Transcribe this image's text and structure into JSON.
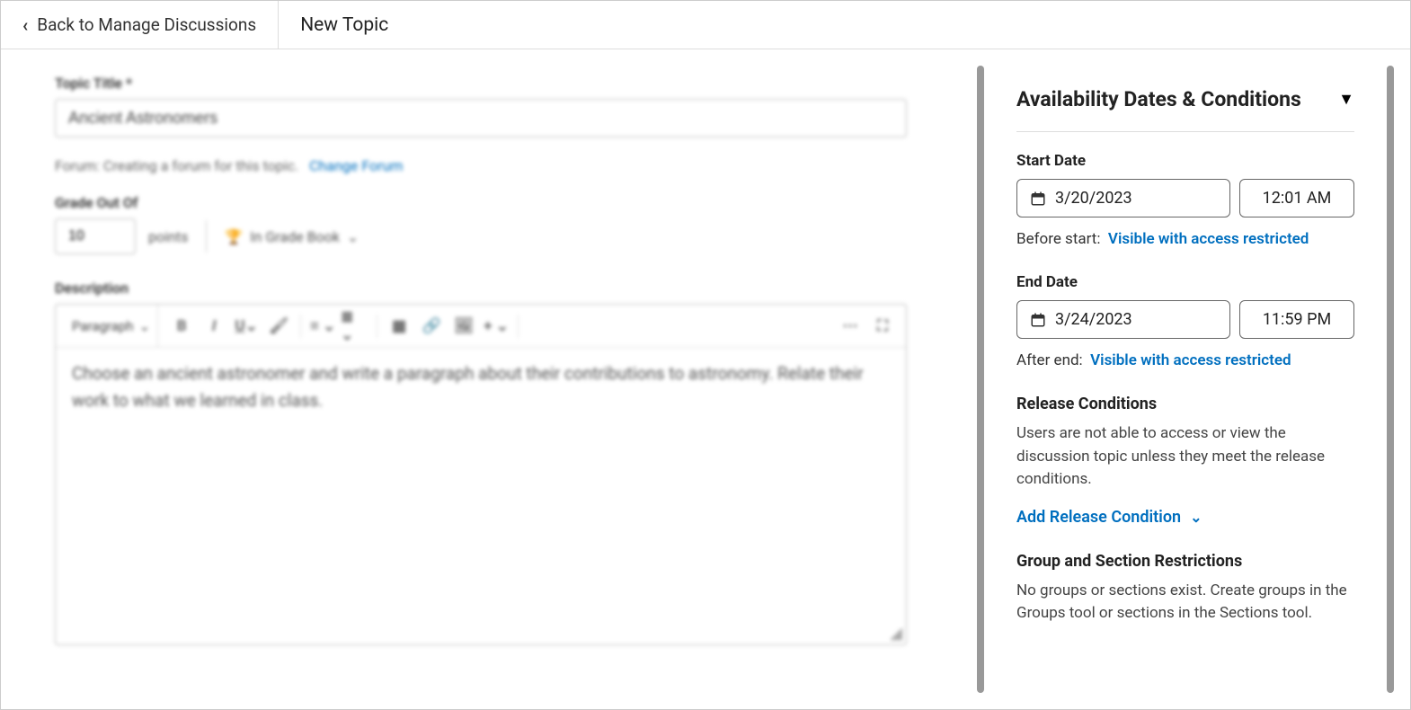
{
  "header": {
    "back_label": "Back to Manage Discussions",
    "page_title": "New Topic"
  },
  "main": {
    "topic_title_label": "Topic Title",
    "topic_title_value": "Ancient Astronomers",
    "forum_text": "Forum: Creating a forum for this topic.",
    "forum_link": "Change Forum",
    "grade_label": "Grade Out Of",
    "grade_value": "10",
    "grade_points": "points",
    "grade_book": "In Grade Book",
    "description_label": "Description",
    "editor_format": "Paragraph",
    "description_text": "Choose an ancient astronomer and write a paragraph about their contributions to astronomy. Relate their work to what we learned in class."
  },
  "side": {
    "title": "Availability Dates & Conditions",
    "start_label": "Start Date",
    "start_date": "3/20/2023",
    "start_time": "12:01 AM",
    "before_start_label": "Before start:",
    "before_start_value": "Visible with access restricted",
    "end_label": "End Date",
    "end_date": "3/24/2023",
    "end_time": "11:59 PM",
    "after_end_label": "After end:",
    "after_end_value": "Visible with access restricted",
    "release_heading": "Release Conditions",
    "release_desc": "Users are not able to access or view the discussion topic unless they meet the release conditions.",
    "add_release": "Add Release Condition",
    "group_heading": "Group and Section Restrictions",
    "group_desc": "No groups or sections exist. Create groups in the Groups tool or sections in the Sections tool."
  }
}
